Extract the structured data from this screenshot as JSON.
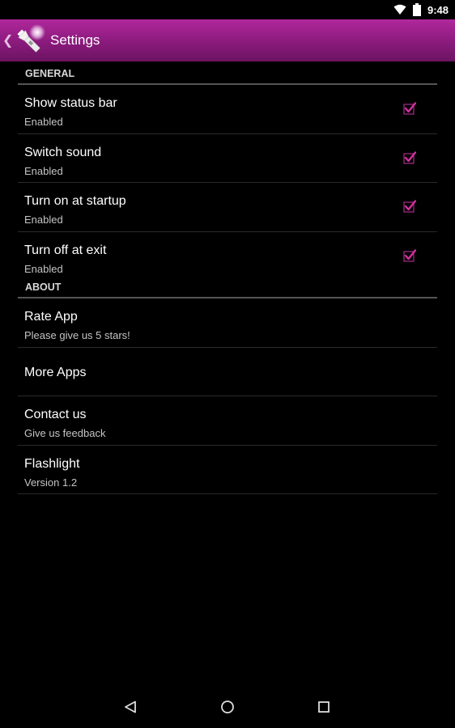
{
  "status_bar": {
    "time": "9:48",
    "icons": [
      "wifi-icon",
      "battery-icon"
    ]
  },
  "action_bar": {
    "title": "Settings",
    "up_icon": "chevron-left-icon",
    "app_icon": "flashlight-icon"
  },
  "general": {
    "header": "GENERAL",
    "items": [
      {
        "title": "Show status bar",
        "summary": "Enabled",
        "checked": true
      },
      {
        "title": "Switch sound",
        "summary": "Enabled",
        "checked": true
      },
      {
        "title": "Turn on at startup",
        "summary": "Enabled",
        "checked": true
      },
      {
        "title": "Turn off at exit",
        "summary": "Enabled",
        "checked": true
      }
    ]
  },
  "about": {
    "header": "ABOUT",
    "items": [
      {
        "title": "Rate App",
        "summary": "Please give us 5 stars!"
      },
      {
        "title": "More Apps",
        "summary": ""
      },
      {
        "title": "Contact us",
        "summary": "Give us feedback"
      },
      {
        "title": "Flashlight",
        "summary": "Version 1.2"
      }
    ]
  },
  "colors": {
    "accent": "#b0289c",
    "checkbox": "#c0278c"
  }
}
